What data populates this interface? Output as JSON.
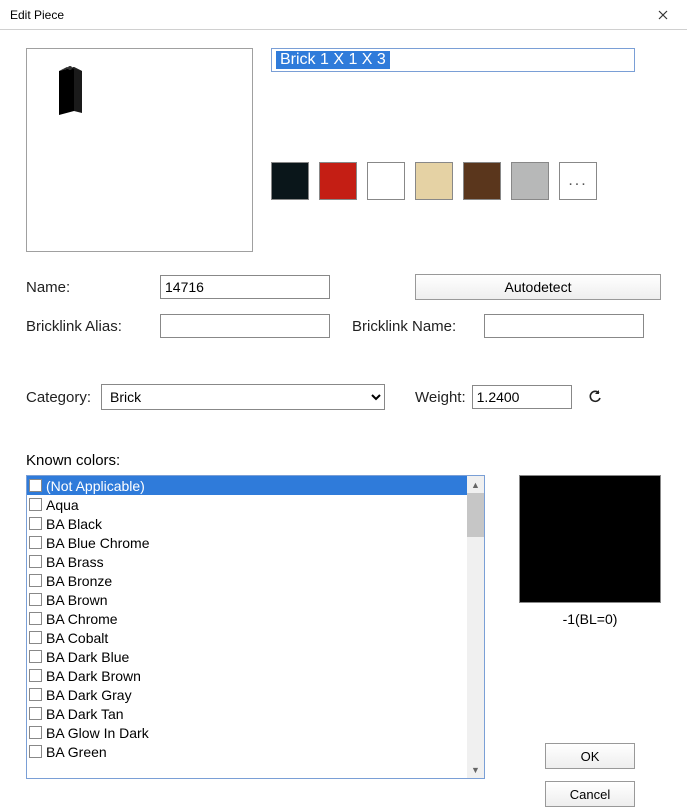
{
  "window": {
    "title": "Edit Piece"
  },
  "piece": {
    "title": "Brick 1 X 1 X 3"
  },
  "swatches": [
    {
      "name": "black",
      "color": "#0a161a"
    },
    {
      "name": "red",
      "color": "#c41e14"
    },
    {
      "name": "white",
      "color": "#ffffff"
    },
    {
      "name": "tan",
      "color": "#e5d2a4"
    },
    {
      "name": "brown",
      "color": "#5a361c"
    },
    {
      "name": "lightgray",
      "color": "#b7b8b8"
    }
  ],
  "more_swatch": "...",
  "labels": {
    "name": "Name:",
    "bl_alias": "Bricklink Alias:",
    "bl_name": "Bricklink Name:",
    "category": "Category:",
    "weight": "Weight:",
    "known": "Known colors:"
  },
  "fields": {
    "name": "14716",
    "bl_alias": "",
    "bl_name": "",
    "category": "Brick",
    "weight": "1.2400"
  },
  "buttons": {
    "autodetect": "Autodetect",
    "ok": "OK",
    "cancel": "Cancel"
  },
  "known_colors": [
    "(Not Applicable)",
    "Aqua",
    "BA Black",
    "BA Blue Chrome",
    "BA Brass",
    "BA Bronze",
    "BA Brown",
    "BA Chrome",
    "BA Cobalt",
    "BA Dark Blue",
    "BA Dark Brown",
    "BA Dark Gray",
    "BA Dark Tan",
    "BA Glow In Dark",
    "BA Green"
  ],
  "color_preview": {
    "label": "-1(BL=0)",
    "color": "#000000"
  }
}
